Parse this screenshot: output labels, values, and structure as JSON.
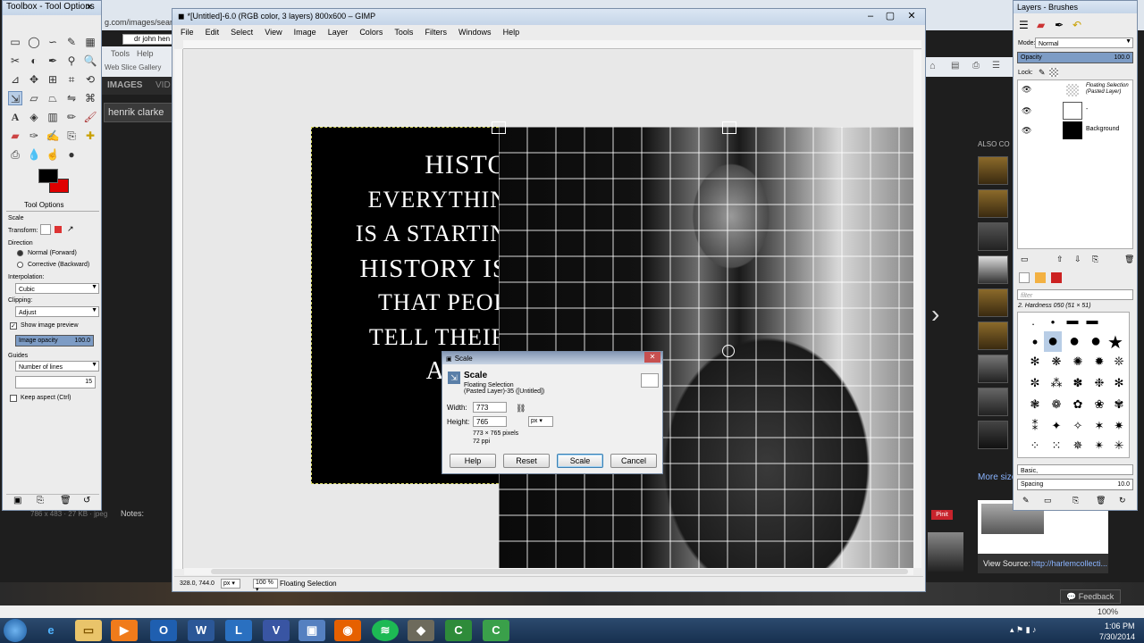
{
  "browser": {
    "url_fragment": "g.com/images/sear",
    "tab_label": "dr john hen",
    "tools_menu": "Tools",
    "help_menu": "Help",
    "web_slice": "Web Slice Gallery",
    "images_tab": "IMAGES",
    "videos_tab": "VID",
    "search_query": "henrik clarke",
    "also_label": "ALSO CO",
    "more_sizes": "More size",
    "view_source_label": "View Source:",
    "view_source_url": "http://harlemcollecti...",
    "pinit": "Pinit",
    "notes_label": "Notes:",
    "size_info": "786 x 483 · 27 KB · jpeg",
    "feedback": "Feedback",
    "zoom": "100%"
  },
  "toolbox": {
    "title": "Toolbox - Tool Options",
    "options_tab": "Tool Options",
    "tool_name": "Scale",
    "transform_label": "Transform:",
    "direction_label": "Direction",
    "direction_forward": "Normal (Forward)",
    "direction_corrective": "Corrective (Backward)",
    "interpolation_label": "Interpolation:",
    "interpolation_value": "Cubic",
    "clipping_label": "Clipping:",
    "clipping_value": "Adjust",
    "show_preview": "Show image preview",
    "image_opacity_label": "Image opacity",
    "image_opacity_value": "100.0",
    "guides_label": "Guides",
    "guides_value": "Number of lines",
    "lines_value": "15",
    "keep_aspect": "Keep aspect (Ctrl)"
  },
  "gimp": {
    "title": "*[Untitled]-6.0 (RGB color, 3 layers) 800x600 – GIMP",
    "menu": [
      "File",
      "Edit",
      "Select",
      "View",
      "Image",
      "Layer",
      "Colors",
      "Tools",
      "Filters",
      "Windows",
      "Help"
    ],
    "coords": "328.0, 744.0",
    "unit": "px",
    "zoom": "100 %",
    "status": "Floating Selection",
    "canvas_text": [
      "HISTO",
      "EVERYTHIN",
      "IS A STARTIN",
      "HISTORY IS",
      "THAT PEOP",
      "TELL THEIR",
      "AND C"
    ]
  },
  "scale_dialog": {
    "title": "Scale",
    "heading": "Scale",
    "subtitle1": "Floating Selection",
    "subtitle2": "(Pasted Layer)-35 ([Untitled])",
    "width_label": "Width:",
    "width_value": "773",
    "height_label": "Height:",
    "height_value": "765",
    "unit": "px",
    "dims": "773 × 765 pixels",
    "ppi": "72 ppi",
    "help": "Help",
    "reset": "Reset",
    "scale": "Scale",
    "cancel": "Cancel"
  },
  "layers": {
    "title": "Layers - Brushes",
    "mode_label": "Mode:",
    "mode_value": "Normal",
    "opacity_label": "Opacity",
    "opacity_value": "100.0",
    "lock_label": "Lock:",
    "layer_items": [
      "Floating Selection (Pasted Layer)",
      "-",
      "Background"
    ],
    "filter_placeholder": "filter",
    "brush_name": "2. Hardness 050 (51 × 51)",
    "preset_label": "Basic,",
    "spacing_label": "Spacing",
    "spacing_value": "10.0"
  },
  "taskbar": {
    "time": "1:06 PM",
    "date": "7/30/2014"
  },
  "colors": {
    "accent": "#3399ff",
    "taskbar": "#1f3a5a",
    "gimp_bg": "#ececec"
  }
}
